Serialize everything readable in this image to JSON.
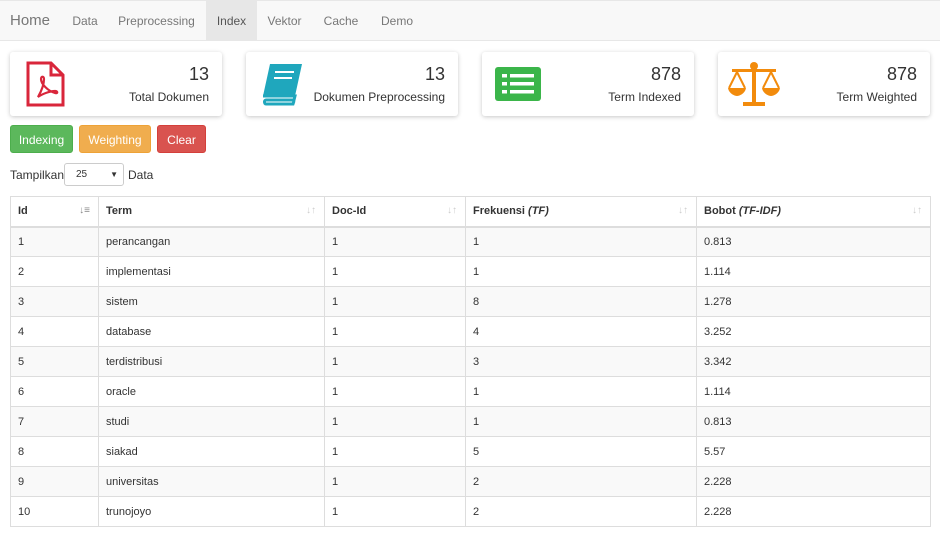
{
  "navbar": {
    "brand": "Home",
    "items": [
      {
        "label": "Data"
      },
      {
        "label": "Preprocessing"
      },
      {
        "label": "Index"
      },
      {
        "label": "Vektor"
      },
      {
        "label": "Cache"
      },
      {
        "label": "Demo"
      }
    ],
    "active": "Index"
  },
  "stats": [
    {
      "value": "13",
      "label": "Total Dokumen",
      "icon": "pdf-icon",
      "color": "#d9263b"
    },
    {
      "value": "13",
      "label": "Dokumen Preprocessing",
      "icon": "book-icon",
      "color": "#1fa7bd"
    },
    {
      "value": "878",
      "label": "Term Indexed",
      "icon": "list-icon",
      "color": "#3bb54a"
    },
    {
      "value": "878",
      "label": "Term Weighted",
      "icon": "balance-scale-icon",
      "color": "#f28b0c"
    }
  ],
  "actions": {
    "indexing": "Indexing",
    "weighting": "Weighting",
    "clear": "Clear"
  },
  "length_control": {
    "prefix": "Tampilkan",
    "value": "25",
    "suffix": "Data"
  },
  "table": {
    "columns": [
      {
        "label": "Id"
      },
      {
        "label": "Term"
      },
      {
        "label": "Doc-Id"
      },
      {
        "label": "Frekuensi",
        "italic": "(TF)"
      },
      {
        "label": "Bobot",
        "italic": "(TF-IDF)"
      }
    ],
    "rows": [
      [
        "1",
        "perancangan",
        "1",
        "1",
        "0.813"
      ],
      [
        "2",
        "implementasi",
        "1",
        "1",
        "1.114"
      ],
      [
        "3",
        "sistem",
        "1",
        "8",
        "1.278"
      ],
      [
        "4",
        "database",
        "1",
        "4",
        "3.252"
      ],
      [
        "5",
        "terdistribusi",
        "1",
        "3",
        "3.342"
      ],
      [
        "6",
        "oracle",
        "1",
        "1",
        "1.114"
      ],
      [
        "7",
        "studi",
        "1",
        "1",
        "0.813"
      ],
      [
        "8",
        "siakad",
        "1",
        "5",
        "5.57"
      ],
      [
        "9",
        "universitas",
        "1",
        "2",
        "2.228"
      ],
      [
        "10",
        "trunojoyo",
        "1",
        "2",
        "2.228"
      ]
    ]
  }
}
